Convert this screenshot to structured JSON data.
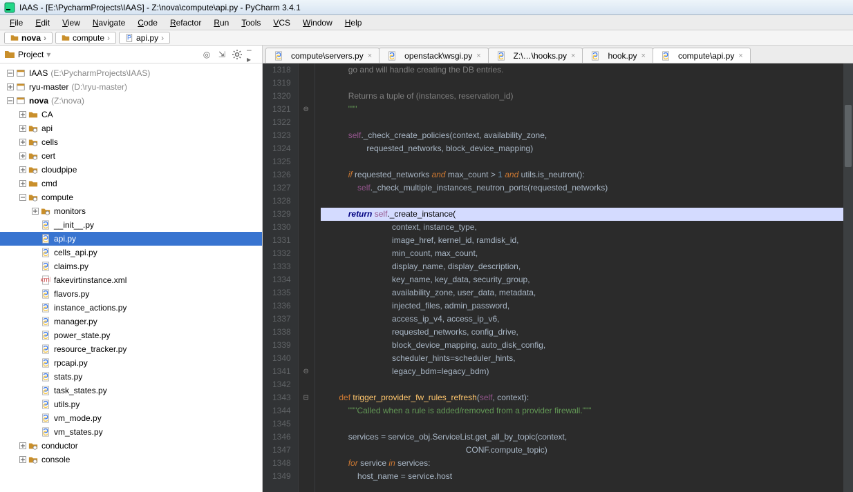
{
  "window": {
    "title": "IAAS - [E:\\PycharmProjects\\IAAS] - Z:\\nova\\compute\\api.py - PyCharm 3.4.1"
  },
  "menu": {
    "items": [
      "File",
      "Edit",
      "View",
      "Navigate",
      "Code",
      "Refactor",
      "Run",
      "Tools",
      "VCS",
      "Window",
      "Help"
    ]
  },
  "breadcrumbs": {
    "items": [
      "nova",
      "compute",
      "api.py"
    ]
  },
  "side_header": {
    "label": "Project",
    "tools": [
      "target-icon",
      "collapse-icon",
      "gear-icon",
      "hide-icon"
    ]
  },
  "tree": [
    {
      "depth": 0,
      "exp": "minus",
      "icon": "proj",
      "text": "IAAS",
      "muted": "(E:\\PycharmProjects\\IAAS)"
    },
    {
      "depth": 0,
      "exp": "plus",
      "icon": "proj",
      "text": "ryu-master",
      "muted": "(D:\\ryu-master)"
    },
    {
      "depth": 0,
      "exp": "minus",
      "icon": "proj",
      "text": "nova",
      "muted": "(Z:\\nova)",
      "bold": true
    },
    {
      "depth": 1,
      "exp": "plus",
      "icon": "folder",
      "text": "CA"
    },
    {
      "depth": 1,
      "exp": "plus",
      "icon": "pkg",
      "text": "api"
    },
    {
      "depth": 1,
      "exp": "plus",
      "icon": "pkg",
      "text": "cells"
    },
    {
      "depth": 1,
      "exp": "plus",
      "icon": "pkg",
      "text": "cert"
    },
    {
      "depth": 1,
      "exp": "plus",
      "icon": "pkg",
      "text": "cloudpipe"
    },
    {
      "depth": 1,
      "exp": "plus",
      "icon": "folder",
      "text": "cmd"
    },
    {
      "depth": 1,
      "exp": "minus",
      "icon": "pkg",
      "text": "compute"
    },
    {
      "depth": 2,
      "exp": "plus",
      "icon": "pkg",
      "text": "monitors"
    },
    {
      "depth": 2,
      "exp": "none",
      "icon": "py",
      "text": "__init__.py"
    },
    {
      "depth": 2,
      "exp": "none",
      "icon": "py",
      "text": "api.py",
      "selected": true
    },
    {
      "depth": 2,
      "exp": "none",
      "icon": "py",
      "text": "cells_api.py"
    },
    {
      "depth": 2,
      "exp": "none",
      "icon": "py",
      "text": "claims.py"
    },
    {
      "depth": 2,
      "exp": "none",
      "icon": "xml",
      "text": "fakevirtinstance.xml"
    },
    {
      "depth": 2,
      "exp": "none",
      "icon": "py",
      "text": "flavors.py"
    },
    {
      "depth": 2,
      "exp": "none",
      "icon": "py",
      "text": "instance_actions.py"
    },
    {
      "depth": 2,
      "exp": "none",
      "icon": "py",
      "text": "manager.py"
    },
    {
      "depth": 2,
      "exp": "none",
      "icon": "py",
      "text": "power_state.py"
    },
    {
      "depth": 2,
      "exp": "none",
      "icon": "py",
      "text": "resource_tracker.py"
    },
    {
      "depth": 2,
      "exp": "none",
      "icon": "py",
      "text": "rpcapi.py"
    },
    {
      "depth": 2,
      "exp": "none",
      "icon": "py",
      "text": "stats.py"
    },
    {
      "depth": 2,
      "exp": "none",
      "icon": "py",
      "text": "task_states.py"
    },
    {
      "depth": 2,
      "exp": "none",
      "icon": "py",
      "text": "utils.py"
    },
    {
      "depth": 2,
      "exp": "none",
      "icon": "py",
      "text": "vm_mode.py"
    },
    {
      "depth": 2,
      "exp": "none",
      "icon": "py",
      "text": "vm_states.py"
    },
    {
      "depth": 1,
      "exp": "plus",
      "icon": "pkg",
      "text": "conductor"
    },
    {
      "depth": 1,
      "exp": "plus",
      "icon": "pkg",
      "text": "console"
    }
  ],
  "tabs": [
    {
      "icon": "py",
      "label": "compute\\servers.py",
      "active": false
    },
    {
      "icon": "py",
      "label": "openstack\\wsgi.py",
      "active": false
    },
    {
      "icon": "py",
      "label": "Z:\\…\\hooks.py",
      "active": false
    },
    {
      "icon": "py",
      "label": "hook.py",
      "active": false
    },
    {
      "icon": "py",
      "label": "compute\\api.py",
      "active": true
    }
  ],
  "editor": {
    "first_line": 1318,
    "highlight_line": 1329,
    "lines": [
      {
        "n": 1318,
        "html": "            <span class='cmnt'>go and will handle creating the DB entries.</span>"
      },
      {
        "n": 1319,
        "html": ""
      },
      {
        "n": 1320,
        "html": "            <span class='cmnt'>Returns a tuple of (instances, reservation_id)</span>"
      },
      {
        "n": 1321,
        "html": "            <span class='str'>\"\"\"</span>",
        "fold": "up"
      },
      {
        "n": 1322,
        "html": ""
      },
      {
        "n": 1323,
        "html": "            <span class='self'>self</span>._check_create_policies(context<span class='op'>,</span> availability_zone<span class='op'>,</span>"
      },
      {
        "n": 1324,
        "html": "                    requested_networks<span class='op'>,</span> block_device_mapping)"
      },
      {
        "n": 1325,
        "html": ""
      },
      {
        "n": 1326,
        "html": "            <span class='kw'>if</span> requested_networks <span class='kw'>and</span> max_count <span class='op'>&gt;</span> <span class='num'>1</span> <span class='kw'>and</span> utils.is_neutron()<span class='op'>:</span>"
      },
      {
        "n": 1327,
        "html": "                <span class='self'>self</span>._check_multiple_instances_neutron_ports(requested_networks)"
      },
      {
        "n": 1328,
        "html": ""
      },
      {
        "n": 1329,
        "html": "            <span class='kw'>return</span> <span class='self'>self</span>._create_instance(",
        "hl": true
      },
      {
        "n": 1330,
        "html": "                               context<span class='op'>,</span> instance_type<span class='op'>,</span>"
      },
      {
        "n": 1331,
        "html": "                               image_href<span class='op'>,</span> kernel_id<span class='op'>,</span> ramdisk_id<span class='op'>,</span>"
      },
      {
        "n": 1332,
        "html": "                               min_count<span class='op'>,</span> max_count<span class='op'>,</span>"
      },
      {
        "n": 1333,
        "html": "                               display_name<span class='op'>,</span> display_description<span class='op'>,</span>"
      },
      {
        "n": 1334,
        "html": "                               key_name<span class='op'>,</span> key_data<span class='op'>,</span> security_group<span class='op'>,</span>"
      },
      {
        "n": 1335,
        "html": "                               availability_zone<span class='op'>,</span> user_data<span class='op'>,</span> metadata<span class='op'>,</span>"
      },
      {
        "n": 1336,
        "html": "                               injected_files<span class='op'>,</span> admin_password<span class='op'>,</span>"
      },
      {
        "n": 1337,
        "html": "                               access_ip_v4<span class='op'>,</span> access_ip_v6<span class='op'>,</span>"
      },
      {
        "n": 1338,
        "html": "                               requested_networks<span class='op'>,</span> config_drive<span class='op'>,</span>"
      },
      {
        "n": 1339,
        "html": "                               block_device_mapping<span class='op'>,</span> auto_disk_config<span class='op'>,</span>"
      },
      {
        "n": 1340,
        "html": "                               <span class='arg'>scheduler_hints</span><span class='op'>=</span>scheduler_hints<span class='op'>,</span>"
      },
      {
        "n": 1341,
        "html": "                               <span class='arg'>legacy_bdm</span><span class='op'>=</span>legacy_bdm)",
        "fold": "up"
      },
      {
        "n": 1342,
        "html": ""
      },
      {
        "n": 1343,
        "html": "        <span class='kw2'>def</span> <span class='call'>trigger_provider_fw_rules_refresh</span>(<span class='self'>self</span><span class='op'>,</span> context)<span class='op'>:</span>",
        "fold": "down"
      },
      {
        "n": 1344,
        "html": "            <span class='str'>\"\"\"Called when a rule is added/removed from a provider firewall.\"\"\"</span>"
      },
      {
        "n": 1345,
        "html": ""
      },
      {
        "n": 1346,
        "html": "            services <span class='op'>=</span> service_obj.ServiceList.get_all_by_topic(context<span class='op'>,</span>"
      },
      {
        "n": 1347,
        "html": "                                                               CONF.compute_topic)"
      },
      {
        "n": 1348,
        "html": "            <span class='kw'>for</span> service <span class='kw'>in</span> services<span class='op'>:</span>"
      },
      {
        "n": 1349,
        "html": "                host_name <span class='op'>=</span> service.host"
      }
    ]
  }
}
